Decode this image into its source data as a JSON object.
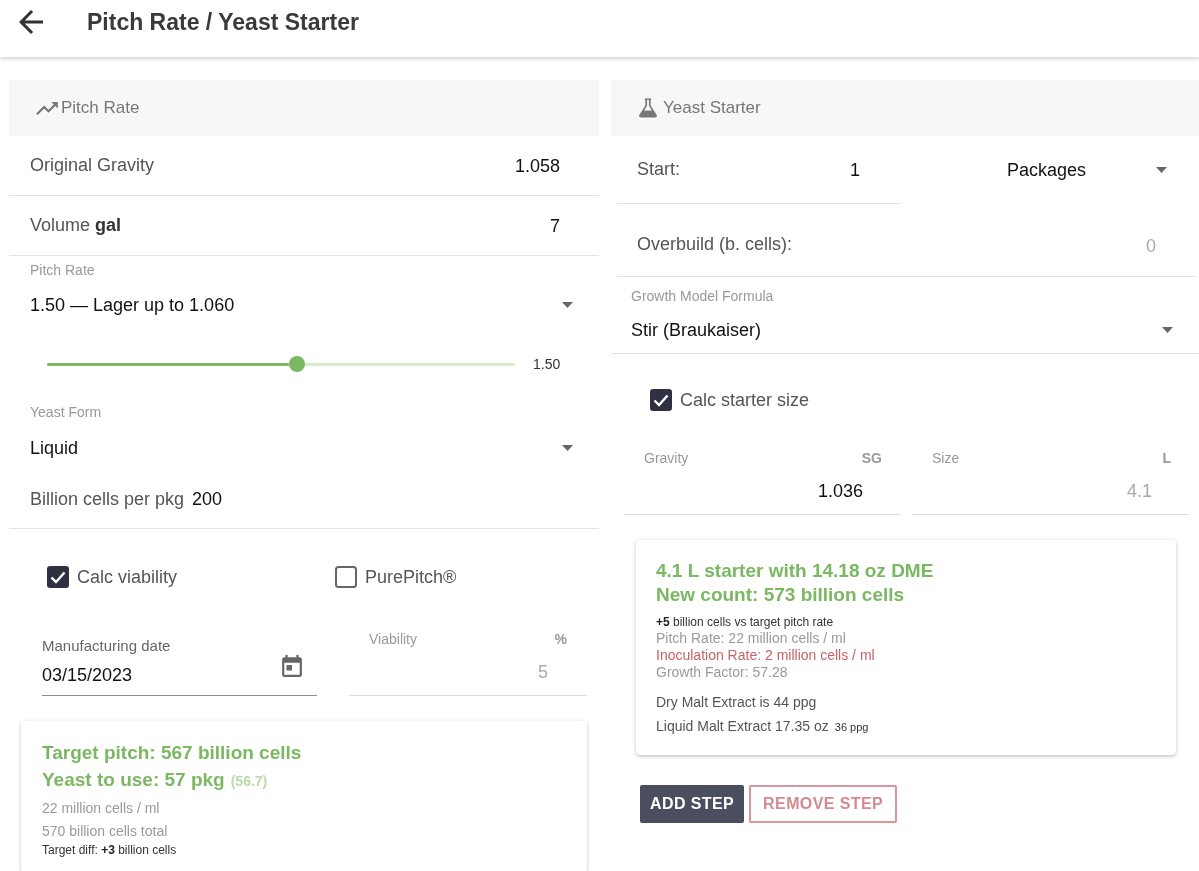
{
  "app_bar": {
    "title": "Pitch Rate / Yeast Starter"
  },
  "pitch_rate": {
    "title": "Pitch Rate",
    "fields": [
      {
        "label": "Original Gravity",
        "value": "1.058"
      },
      {
        "label": "Volume **gal**",
        "value": "7"
      }
    ],
    "pitch_rate_select": {
      "label": "Pitch Rate",
      "value": "1.50 — Lager up to 1.060"
    },
    "slider": {
      "level": 0.534,
      "reading": "1.50"
    },
    "yeast_form_select": {
      "label": "Yeast Form",
      "value": "Liquid"
    },
    "cells_per_pkg": {
      "label": "Billion cells per pkg",
      "value": "200"
    },
    "checkboxes": [
      {
        "label": "Calc viability",
        "checked": true
      },
      {
        "label": "PurePitch®",
        "checked": false
      }
    ],
    "manufacturing_date": {
      "label": "Manufacturing date",
      "value": "03/15/2023"
    },
    "viability": {
      "label": "Viability",
      "unit": "%",
      "value": "5",
      "disabled": true
    },
    "result": {
      "lines": [
        {
          "kind": "headline",
          "text": "Target pitch: 567 billion cells"
        },
        {
          "kind": "headline",
          "text": "Yeast to use: 57 pkg",
          "extra": "(56.7)"
        },
        {
          "kind": "info",
          "text": "22 million cells / ml"
        },
        {
          "kind": "info",
          "text": "570 billion cells total"
        },
        {
          "kind": "note",
          "text": "Target diff: **+3** billion cells"
        }
      ]
    }
  },
  "yeast_starter": {
    "title": "Yeast Starter",
    "start": {
      "label": "Start:",
      "value": "1",
      "unit": "Packages"
    },
    "overbuild": {
      "label": "Overbuild (b. cells):",
      "placeholder": "0"
    },
    "growth_model_select": {
      "label": "Growth Model Formula",
      "value": "Stir (Braukaiser)"
    },
    "calc_starter_size": {
      "label": "Calc starter size",
      "checked": true
    },
    "starter_fields": [
      {
        "label": "Gravity",
        "unit": "SG",
        "value": "1.036",
        "disabled": false
      },
      {
        "label": "Size",
        "unit": "L",
        "value": "4.1",
        "disabled": true
      }
    ],
    "result": {
      "lines": [
        {
          "kind": "headline",
          "text": "4.1 L starter with 14.18 oz DME"
        },
        {
          "kind": "headline",
          "text": "New count: 573 billion cells"
        },
        {
          "kind": "note",
          "text": "**+5** billion cells vs target pitch rate"
        },
        {
          "kind": "info",
          "text": "Pitch Rate: 22 million cells / ml"
        },
        {
          "kind": "warning",
          "text": "Inoculation Rate: 2 million cells / ml"
        },
        {
          "kind": "info",
          "text": "Growth Factor: 57.28"
        },
        {
          "kind": "extract",
          "text": "Dry Malt Extract is 44 ppg"
        },
        {
          "kind": "extract",
          "text": "Liquid Malt Extract 17.35 oz",
          "extra": "36 ppg"
        }
      ]
    },
    "buttons": [
      {
        "label": "ADD STEP",
        "kind": "primary"
      },
      {
        "label": "REMOVE STEP",
        "kind": "outlined"
      }
    ]
  }
}
